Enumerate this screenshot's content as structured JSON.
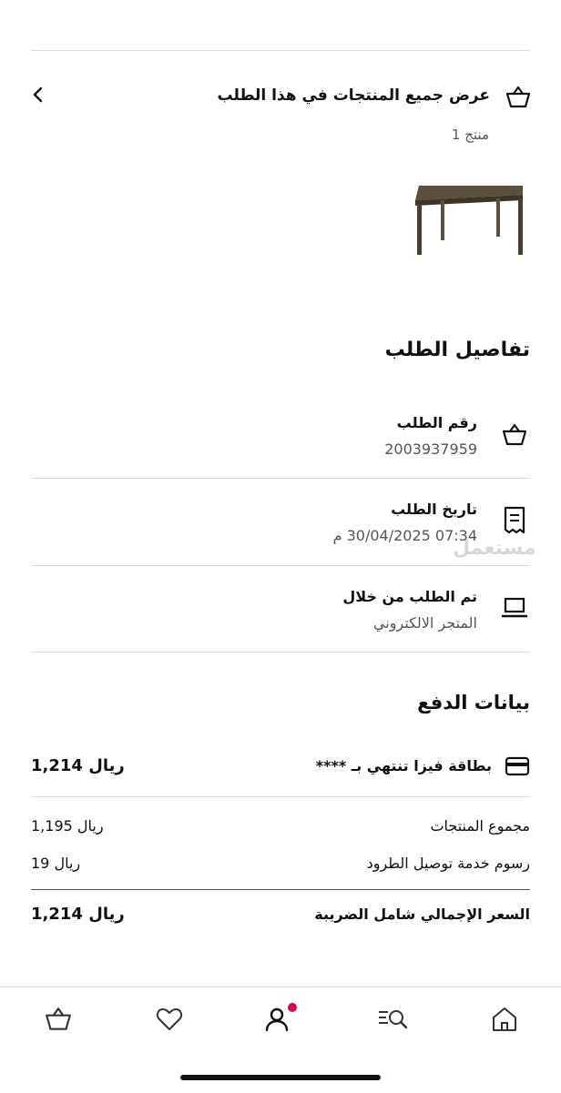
{
  "products": {
    "view_all_label": "عرض جميع المنتجات في هذا الطلب",
    "count_label": "منتج 1",
    "icon": "basket-icon",
    "chevron": "chevron-left-icon"
  },
  "order_details": {
    "title": "تفاصيل الطلب",
    "rows": [
      {
        "label": "رقم الطلب",
        "value": "2003937959",
        "icon": "basket-icon"
      },
      {
        "label": "تاريخ الطلب",
        "value": "07:34 30/04/2025 م",
        "icon": "receipt-icon"
      },
      {
        "label": "تم الطلب من خلال",
        "value": "المتجر الالكتروني",
        "icon": "laptop-icon"
      }
    ]
  },
  "payment": {
    "title": "بيانات الدفع",
    "card_label": "بطاقة فيزا تنتهي بـ ****",
    "card_amount": "1,214 ريال",
    "card_icon": "credit-card-icon",
    "subtotal_label": "مجموع المنتجات",
    "subtotal_value": "1,195 ريال",
    "delivery_label": "رسوم خدمة توصيل الطرود",
    "delivery_value": "19 ريال",
    "total_label": "السعر الإجمالي شامل الضريبة",
    "total_value": "1,214 ريال"
  },
  "watermark": "مستعمل",
  "bottom_nav": [
    {
      "name": "home",
      "icon": "home-icon"
    },
    {
      "name": "search",
      "icon": "search-list-icon"
    },
    {
      "name": "profile",
      "icon": "profile-icon",
      "badge": true
    },
    {
      "name": "favorites",
      "icon": "heart-icon"
    },
    {
      "name": "cart",
      "icon": "basket-icon"
    }
  ],
  "colors": {
    "badge": "#e0004d",
    "text": "#111111",
    "muted": "#555555",
    "divider": "#dcdcdc"
  }
}
